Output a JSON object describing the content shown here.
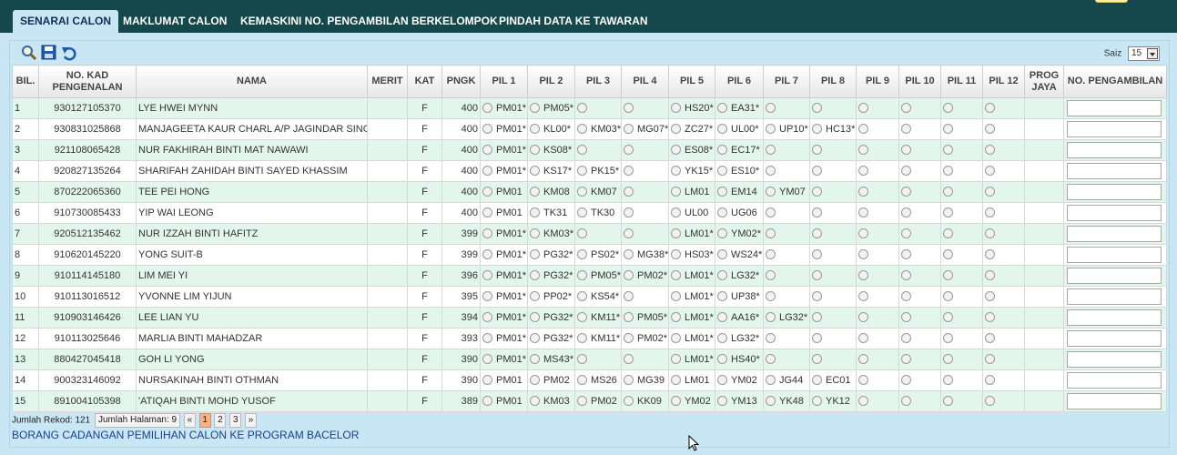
{
  "tabs": [
    {
      "label": "SENARAI CALON",
      "active": true
    },
    {
      "label": "MAKLUMAT CALON",
      "active": false
    },
    {
      "label": "KEMASKINI NO. PENGAMBILAN BERKELOMPOK",
      "active": false
    },
    {
      "label": "PINDAH DATA KE TAWARAN",
      "active": false
    }
  ],
  "toolbar": {
    "icons": [
      "search-icon",
      "save-icon",
      "undo-icon"
    ],
    "saiz_label": "Saiz",
    "saiz_value": "15"
  },
  "columns": {
    "bil": "BIL.",
    "kad": "NO. KAD PENGENALAN",
    "nama": "NAMA",
    "merit": "MERIT",
    "kat": "KAT",
    "pngk": "PNGK",
    "pil": [
      "PIL 1",
      "PIL 2",
      "PIL 3",
      "PIL 4",
      "PIL 5",
      "PIL 6",
      "PIL 7",
      "PIL 8",
      "PIL 9",
      "PIL 10",
      "PIL 11",
      "PIL 12"
    ],
    "prog": "PROG JAYA",
    "ambil": "NO. PENGAMBILAN"
  },
  "rows": [
    {
      "bil": "1",
      "kad": "930127105370",
      "nama": "LYE HWEI MYNN",
      "merit": "",
      "kat": "F",
      "pngk": "400",
      "pil": [
        "PM01*",
        "PM05*",
        "",
        "",
        "HS20*",
        "EA31*",
        "",
        "",
        "",
        "",
        "",
        ""
      ]
    },
    {
      "bil": "2",
      "kad": "930831025868",
      "nama": "MANJAGEETA KAUR CHARL A/P JAGINDAR SINGH",
      "merit": "",
      "kat": "F",
      "pngk": "400",
      "pil": [
        "PM01*",
        "KL00*",
        "KM03*",
        "MG07*",
        "ZC27*",
        "UL00*",
        "UP10*",
        "HC13*",
        "",
        "",
        "",
        ""
      ]
    },
    {
      "bil": "3",
      "kad": "921108065428",
      "nama": "NUR FAKHIRAH BINTI MAT NAWAWI",
      "merit": "",
      "kat": "F",
      "pngk": "400",
      "pil": [
        "PM01*",
        "KS08*",
        "",
        "",
        "ES08*",
        "EC17*",
        "",
        "",
        "",
        "",
        "",
        ""
      ]
    },
    {
      "bil": "4",
      "kad": "920827135264",
      "nama": "SHARIFAH ZAHIDAH BINTI SAYED KHASSIM",
      "merit": "",
      "kat": "F",
      "pngk": "400",
      "pil": [
        "PM01*",
        "KS17*",
        "PK15*",
        "",
        "YK15*",
        "ES10*",
        "",
        "",
        "",
        "",
        "",
        ""
      ]
    },
    {
      "bil": "5",
      "kad": "870222065360",
      "nama": "TEE PEI HONG",
      "merit": "",
      "kat": "F",
      "pngk": "400",
      "pil": [
        "PM01",
        "KM08",
        "KM07",
        "",
        "LM01",
        "EM14",
        "YM07",
        "",
        "",
        "",
        "",
        ""
      ]
    },
    {
      "bil": "6",
      "kad": "910730085433",
      "nama": "YIP WAI LEONG",
      "merit": "",
      "kat": "F",
      "pngk": "400",
      "pil": [
        "PM01",
        "TK31",
        "TK30",
        "",
        "UL00",
        "UG06",
        "",
        "",
        "",
        "",
        "",
        ""
      ]
    },
    {
      "bil": "7",
      "kad": "920512135462",
      "nama": "NUR IZZAH BINTI HAFITZ",
      "merit": "",
      "kat": "F",
      "pngk": "399",
      "pil": [
        "PM01*",
        "KM03*",
        "",
        "",
        "LM01*",
        "YM02*",
        "",
        "",
        "",
        "",
        "",
        ""
      ]
    },
    {
      "bil": "8",
      "kad": "910620145220",
      "nama": "YONG SUIT-B",
      "merit": "",
      "kat": "F",
      "pngk": "399",
      "pil": [
        "PM01*",
        "PG32*",
        "PS02*",
        "MG38*",
        "HS03*",
        "WS24*",
        "",
        "",
        "",
        "",
        "",
        ""
      ]
    },
    {
      "bil": "9",
      "kad": "910114145180",
      "nama": "LIM MEI YI",
      "merit": "",
      "kat": "F",
      "pngk": "396",
      "pil": [
        "PM01*",
        "PG32*",
        "PM05*",
        "PM02*",
        "LM01*",
        "LG32*",
        "",
        "",
        "",
        "",
        "",
        ""
      ]
    },
    {
      "bil": "10",
      "kad": "910113016512",
      "nama": "YVONNE LIM YIJUN",
      "merit": "",
      "kat": "F",
      "pngk": "395",
      "pil": [
        "PM01*",
        "PP02*",
        "KS54*",
        "",
        "LM01*",
        "UP38*",
        "",
        "",
        "",
        "",
        "",
        ""
      ]
    },
    {
      "bil": "11",
      "kad": "910903146426",
      "nama": "LEE LIAN YU",
      "merit": "",
      "kat": "F",
      "pngk": "394",
      "pil": [
        "PM01*",
        "PG32*",
        "KM11*",
        "PM05*",
        "LM01*",
        "AA16*",
        "LG32*",
        "",
        "",
        "",
        "",
        ""
      ]
    },
    {
      "bil": "12",
      "kad": "910113025646",
      "nama": "MARLIA BINTI MAHADZAR",
      "merit": "",
      "kat": "F",
      "pngk": "393",
      "pil": [
        "PM01*",
        "PG32*",
        "KM11*",
        "PM02*",
        "LM01*",
        "LG32*",
        "",
        "",
        "",
        "",
        "",
        ""
      ]
    },
    {
      "bil": "13",
      "kad": "880427045418",
      "nama": "GOH LI YONG",
      "merit": "",
      "kat": "F",
      "pngk": "390",
      "pil": [
        "PM01*",
        "MS43*",
        "",
        "",
        "LM01*",
        "HS40*",
        "",
        "",
        "",
        "",
        "",
        ""
      ]
    },
    {
      "bil": "14",
      "kad": "900323146092",
      "nama": "NURSAKINAH BINTI OTHMAN",
      "merit": "",
      "kat": "F",
      "pngk": "390",
      "pil": [
        "PM01",
        "PM02",
        "MS26",
        "MG39",
        "LM01",
        "YM02",
        "JG44",
        "EC01",
        "",
        "",
        "",
        ""
      ]
    },
    {
      "bil": "15",
      "kad": "891004105398",
      "nama": "'ATIQAH BINTI MOHD YUSOF",
      "merit": "",
      "kat": "F",
      "pngk": "389",
      "pil": [
        "PM01",
        "KM03",
        "PM02",
        "KK09",
        "YM02",
        "YM13",
        "YK48",
        "YK12",
        "",
        "",
        "",
        ""
      ]
    }
  ],
  "footer": {
    "jumlah_rekod": "Jumlah Rekod: 121",
    "jumlah_halaman": "Jumlah Halaman: 9",
    "prev": "«",
    "pages": [
      "1",
      "2",
      "3"
    ],
    "current_page": "1",
    "next": "»",
    "link": "BORANG CADANGAN PEMILIHAN CALON KE PROGRAM BACELOR"
  },
  "colors": {
    "header_bar": "#15484a",
    "panel_bg": "#c9e6f4",
    "row_alt": "#e3f6ec",
    "link": "#1b3f8a",
    "current_page": "#f4b487"
  }
}
